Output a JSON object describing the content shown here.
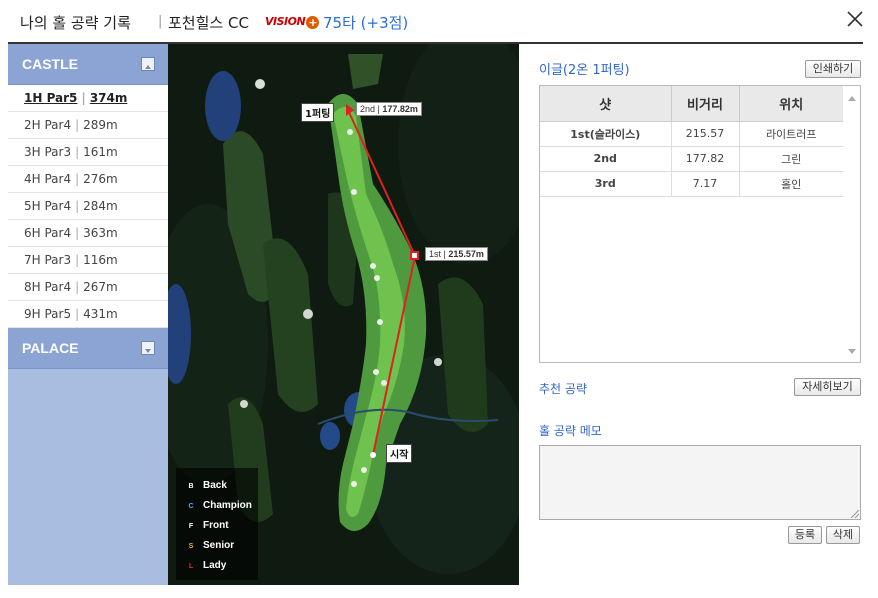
{
  "header": {
    "title": "나의 홀 공략 기록",
    "separator": "|",
    "course": "포천힐스 CC",
    "brand": "VISION",
    "brand_plus": "+",
    "score": "75타 (+3점)",
    "close_icon": "close-icon"
  },
  "sidebar": {
    "courses": [
      {
        "name": "CASTLE",
        "toggle_icon": "collapse-icon"
      },
      {
        "name": "PALACE",
        "toggle_icon": "expand-icon"
      }
    ],
    "holes": [
      {
        "hole": "1H Par5",
        "dist": "374m"
      },
      {
        "hole": "2H Par4",
        "dist": "289m"
      },
      {
        "hole": "3H Par3",
        "dist": "161m"
      },
      {
        "hole": "4H Par4",
        "dist": "276m"
      },
      {
        "hole": "5H Par4",
        "dist": "284m"
      },
      {
        "hole": "6H Par4",
        "dist": "363m"
      },
      {
        "hole": "7H Par3",
        "dist": "116m"
      },
      {
        "hole": "8H Par4",
        "dist": "267m"
      },
      {
        "hole": "9H Par5",
        "dist": "431m"
      }
    ],
    "pipe": "|"
  },
  "map": {
    "shots": [
      {
        "label": "1st",
        "distance": "215.57m"
      },
      {
        "label": "2nd",
        "distance": "177.82m"
      }
    ],
    "pipe": "|",
    "start_label": "시작",
    "green_label": "1퍼팅",
    "tee_legend": [
      {
        "mark": "B",
        "name": "Back",
        "color": "#ffffff"
      },
      {
        "mark": "C",
        "name": "Champion",
        "color": "#55aaee"
      },
      {
        "mark": "F",
        "name": "Front",
        "color": "#ffffff"
      },
      {
        "mark": "S",
        "name": "Senior",
        "color": "#f0b020"
      },
      {
        "mark": "L",
        "name": "Lady",
        "color": "#e03030"
      }
    ]
  },
  "panel": {
    "result_title": "이글(2온 1퍼팅)",
    "print_button": "인쇄하기",
    "columns": [
      "샷",
      "비거리",
      "위치"
    ],
    "rows": [
      {
        "shot": "1st(슬라이스)",
        "distance": "215.57",
        "position": "라이트러프"
      },
      {
        "shot": "2nd",
        "distance": "177.82",
        "position": "그린"
      },
      {
        "shot": "3rd",
        "distance": "7.17",
        "position": "홀인"
      }
    ],
    "recommend_label": "추천 공략",
    "detail_button": "자세히보기",
    "memo_label": "홀 공략 메모",
    "memo_value": "",
    "register_button": "등록",
    "delete_button": "삭제"
  }
}
